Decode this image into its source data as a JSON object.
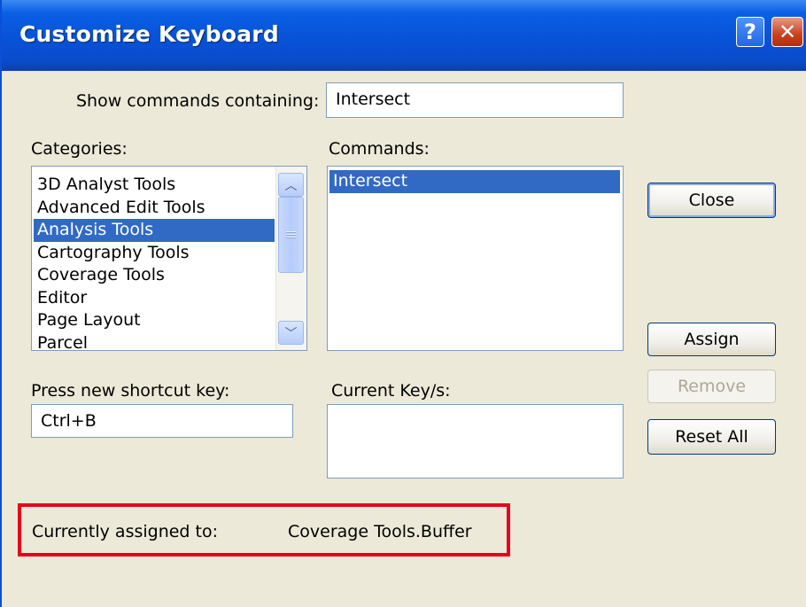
{
  "window": {
    "title": "Customize Keyboard",
    "help_label": "?",
    "close_label": "✕"
  },
  "search": {
    "label": "Show commands containing:",
    "value": "Intersect"
  },
  "categories": {
    "label": "Categories:",
    "items": [
      {
        "label": "3D Analyst Tools",
        "selected": false
      },
      {
        "label": "Advanced Edit Tools",
        "selected": false
      },
      {
        "label": "Analysis Tools",
        "selected": true
      },
      {
        "label": "Cartography Tools",
        "selected": false
      },
      {
        "label": "Coverage Tools",
        "selected": false
      },
      {
        "label": "Editor",
        "selected": false
      },
      {
        "label": "Page Layout",
        "selected": false
      },
      {
        "label": "Parcel",
        "selected": false
      }
    ]
  },
  "commands": {
    "label": "Commands:",
    "items": [
      {
        "label": "Intersect",
        "selected": true
      }
    ]
  },
  "shortcut": {
    "label": "Press new shortcut key:",
    "value": "Ctrl+B"
  },
  "current_keys": {
    "label": "Current Key/s:"
  },
  "buttons": {
    "close": "Close",
    "assign": "Assign",
    "remove": "Remove",
    "reset_all": "Reset All"
  },
  "assigned": {
    "label": "Currently assigned to:",
    "value": "Coverage Tools.Buffer"
  },
  "colors": {
    "titlebar": "#0852d6",
    "dialog_bg": "#ece9d8",
    "selection": "#316ac5",
    "highlight_border": "#e8001c"
  }
}
